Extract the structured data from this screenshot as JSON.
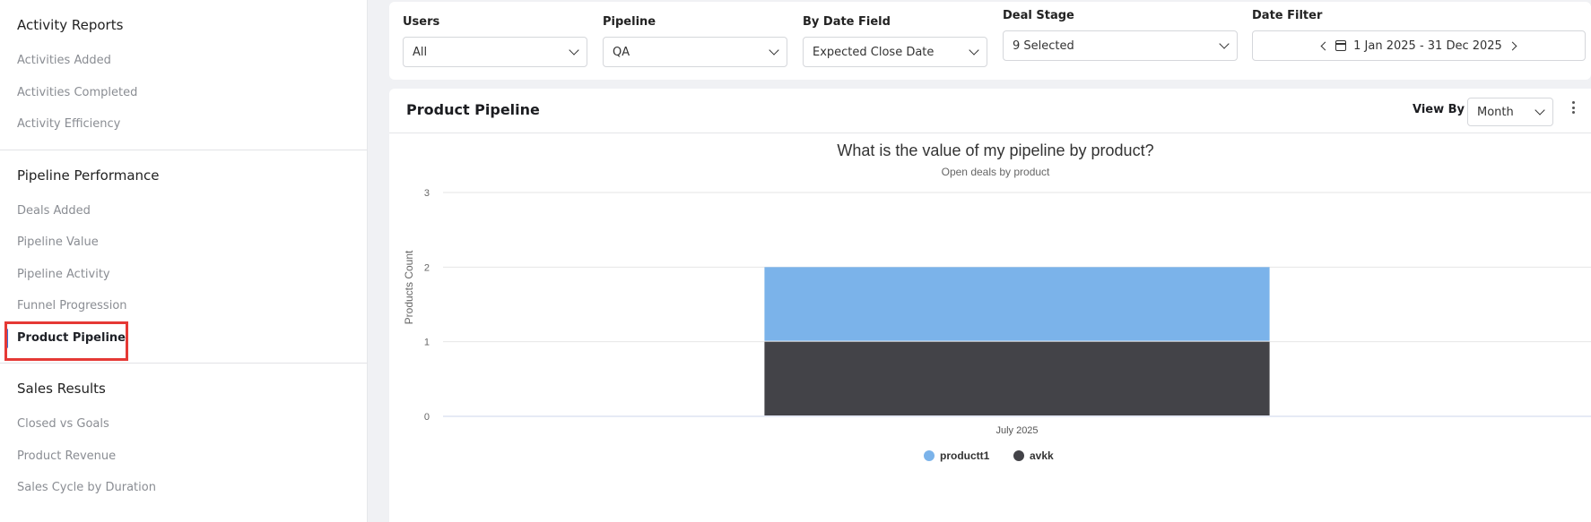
{
  "sidebar": {
    "sections": [
      {
        "title": "Activity Reports",
        "items": [
          "Activities Added",
          "Activities Completed",
          "Activity Efficiency"
        ]
      },
      {
        "title": "Pipeline Performance",
        "items": [
          "Deals Added",
          "Pipeline Value",
          "Pipeline Activity",
          "Funnel Progression",
          "Product Pipeline"
        ]
      },
      {
        "title": "Sales Results",
        "items": [
          "Closed vs Goals",
          "Product Revenue",
          "Sales Cycle by Duration"
        ]
      }
    ]
  },
  "filters": {
    "users": {
      "label": "Users",
      "value": "All"
    },
    "pipeline": {
      "label": "Pipeline",
      "value": "QA"
    },
    "date_field": {
      "label": "By Date Field",
      "value": "Expected Close Date"
    },
    "deal_stage": {
      "label": "Deal Stage",
      "value": "9 Selected"
    },
    "date_filter": {
      "label": "Date Filter",
      "value": "1 Jan 2025 - 31 Dec 2025"
    }
  },
  "card": {
    "title": "Product Pipeline",
    "view_by_label": "View By",
    "view_by_value": "Month"
  },
  "colors": {
    "productt1": "#7bb3ea",
    "avkk": "#434348",
    "accent": "#3b6fd6",
    "highlight": "#e53935"
  },
  "chart_data": {
    "type": "bar",
    "stacked": true,
    "title": "What is the value of my pipeline by product?",
    "subtitle": "Open deals by product",
    "ylabel": "Products Count",
    "xlabel": "",
    "categories": [
      "July 2025"
    ],
    "ylim": [
      0,
      3
    ],
    "yticks": [
      0,
      1,
      2,
      3
    ],
    "grid": true,
    "legend": "bottom",
    "series": [
      {
        "name": "avkk",
        "values": [
          1
        ],
        "color": "#434348"
      },
      {
        "name": "productt1",
        "values": [
          1
        ],
        "color": "#7bb3ea"
      }
    ]
  }
}
